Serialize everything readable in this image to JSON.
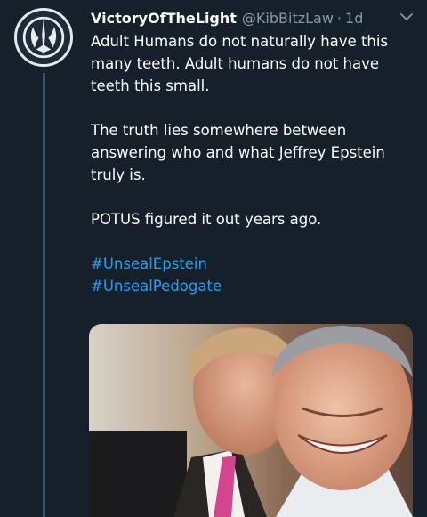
{
  "tweet": {
    "display_name": "VictoryOfTheLight",
    "handle": "@KibBitzLaw",
    "separator": "·",
    "time": "1d",
    "paragraphs": [
      "Adult Humans do not naturally have this many teeth. Adult humans do not have teeth this small.",
      "The truth lies somewhere between answering who and what Jeffrey Epstein truly is.",
      "POTUS figured it out years ago."
    ],
    "hashtags": [
      "#UnsealEpstein",
      "#UnsealPedogate"
    ]
  },
  "icons": {
    "avatar": "jedi-order-emblem-icon",
    "menu": "chevron-down-icon"
  },
  "colors": {
    "background": "#15202b",
    "text": "#ffffff",
    "secondary": "#8899a6",
    "link": "#1da1f2",
    "thread_line": "#3d5466"
  }
}
